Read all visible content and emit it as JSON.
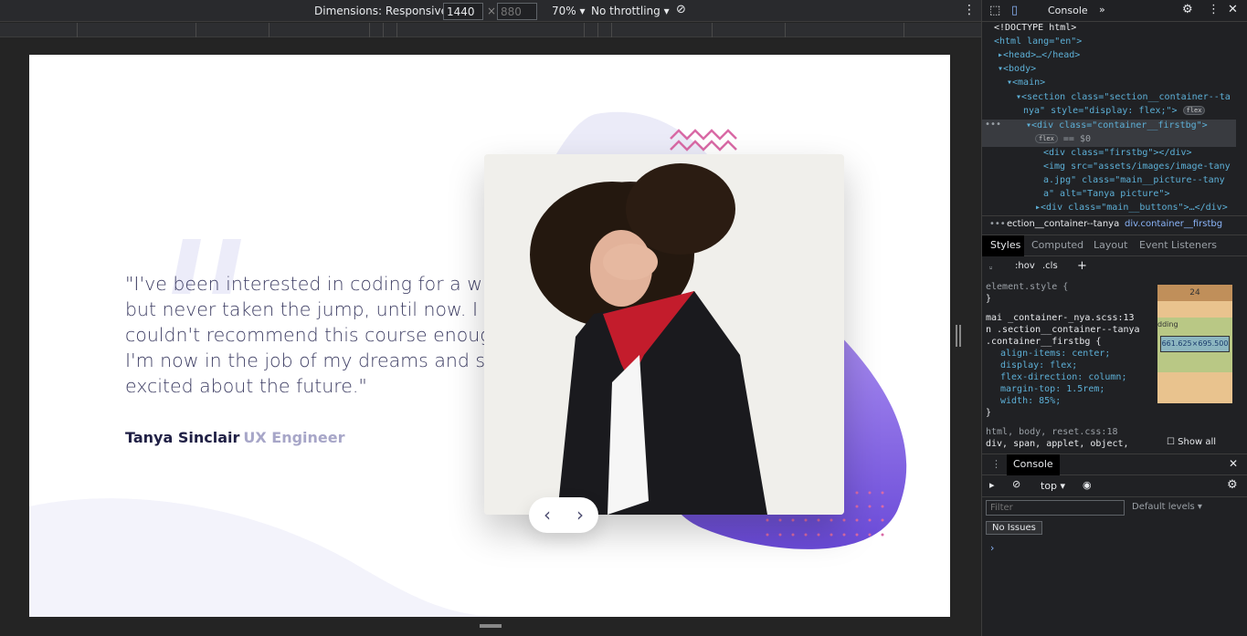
{
  "device_toolbar": {
    "dimensions_label": "Dimensions: Responsive",
    "width": "1440",
    "height_placeholder": "880",
    "zoom": "70%",
    "throttling": "No throttling"
  },
  "page": {
    "quote": "\"I've been interested in coding for a while but never taken the jump, until now. I couldn't recommend this course enough. I'm now in the job of my dreams and so excited about the future.\"",
    "author": "Tanya Sinclair",
    "role": "UX Engineer",
    "prev": "‹",
    "next": "›"
  },
  "devtools": {
    "tab_console": "Console",
    "elements": [
      "<!DOCTYPE html>",
      "<html lang=\"en\">",
      "▸<head>…</head>",
      "▾<body>",
      "▾<main>",
      "▾<section class=\"section__container--ta",
      "nya\" style=\"display: flex;\">",
      "▾<div class=\"container__firstbg\">",
      "== $0",
      "<div class=\"firstbg\"></div>",
      "<img src=\"assets/images/image-tany",
      "a.jpg\" class=\"main__picture--tany",
      "a\" alt=\"Tanya picture\">",
      "▸<div class=\"main__buttons\">…</div>"
    ],
    "breadcrumb1": "ection__container--tanya",
    "breadcrumb2": "div.container__firstbg",
    "style_tabs": [
      "Styles",
      "Computed",
      "Layout",
      "Event Listeners"
    ],
    "filter_hov": ":hov",
    "filter_cls": ".cls",
    "styles": [
      "element.style {",
      "}",
      "mai   _container-_nya.scss:13",
      "n .section__container--tanya",
      ".container__firstbg {",
      "align-items: center;",
      "display: flex;",
      "flex-direction: column;",
      "margin-top: 1.5rem;",
      "width: 85%;",
      "}",
      "html, body,        reset.css:18",
      "div, span, applet, object,"
    ],
    "boxmodel_margin": "24",
    "boxmodel_size": "661.625×695.500",
    "boxmodel_padding": "dding",
    "show_all": "Show all",
    "drawer_tab": "Console",
    "context": "top",
    "filter_placeholder": "Filter",
    "levels": "Default levels",
    "no_issues": "No Issues",
    "flex_badge": "flex"
  },
  "colors": {
    "purple": "#7b5be0",
    "pink": "#e05fa8",
    "text": "#3d3d63"
  }
}
